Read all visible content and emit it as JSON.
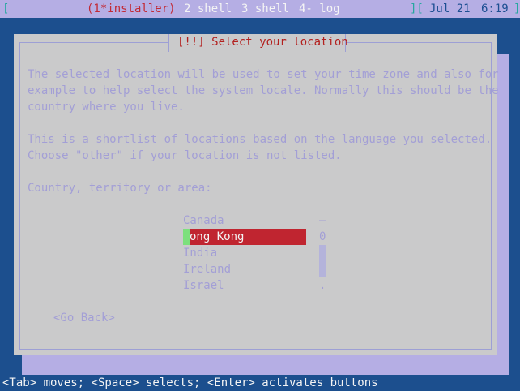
{
  "status_bar": {
    "open_bracket": "[",
    "window1": "(1*installer)",
    "window2": "2 shell",
    "window3": "3 shell",
    "window4": "4- log",
    "separator": "][",
    "date": "Jul 21",
    "time": "6:19",
    "close_bracket": "]"
  },
  "dialog": {
    "title": "[!!] Select your location",
    "paragraph1_lines": [
      "The selected location will be used to set your time zone and also for",
      "example to help select the system locale. Normally this should be the",
      "country where you live."
    ],
    "paragraph2_lines": [
      "This is a shortlist of locations based on the language you selected.",
      "Choose \"other\" if your location is not listed."
    ],
    "prompt": "Country, territory or area:",
    "options": [
      "Canada",
      "Hong Kong",
      "India",
      "Ireland",
      "Israel"
    ],
    "selected_option_visible_label": "ong Kong",
    "scrollbar_glyphs": [
      "–",
      "0",
      "."
    ],
    "go_back_label": "<Go Back>"
  },
  "help_line": "<Tab> moves; <Space> selects; <Enter> activates buttons",
  "colors": {
    "background": "#1c4f8e",
    "dialog_bg": "#cacacb",
    "title_red": "#b3201e",
    "selection_red": "#c02530",
    "cursor_green": "#7de07d",
    "muted_text": "#a39fd6",
    "status_bar_bg": "#b5aee4"
  }
}
